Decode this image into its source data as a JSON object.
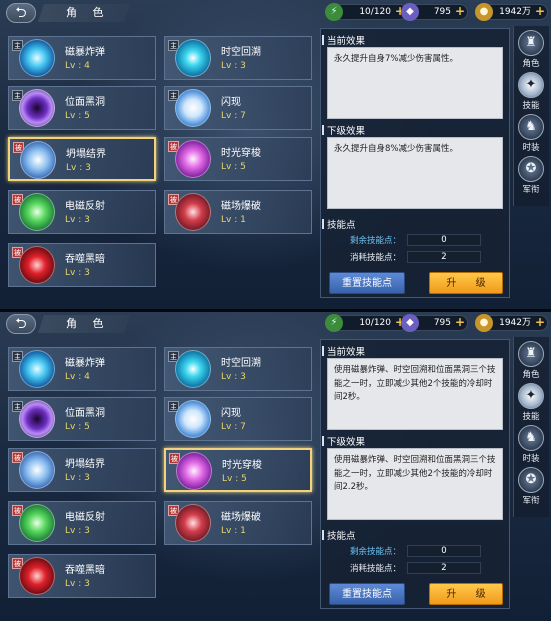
{
  "panels": [
    {
      "header": {
        "back_label": "⮌",
        "title": "角 色"
      },
      "resources": {
        "energy": "10/120",
        "gems": "795",
        "gold": "1942万",
        "plus": "+"
      },
      "skills": [
        {
          "name": "磁暴炸弹",
          "level": "Lv : 4",
          "badge": "主",
          "color": "cyan",
          "selected": false
        },
        {
          "name": "时空回溯",
          "level": "Lv : 3",
          "badge": "主",
          "color": "teal",
          "selected": false
        },
        {
          "name": "位面黑洞",
          "level": "Lv : 5",
          "badge": "主",
          "color": "purple",
          "selected": false
        },
        {
          "name": "闪现",
          "level": "Lv : 7",
          "badge": "主",
          "color": "white",
          "selected": false
        },
        {
          "name": "坍塌结界",
          "level": "Lv : 3",
          "badge": "被",
          "color": "ice",
          "selected": true
        },
        {
          "name": "时光穿梭",
          "level": "Lv : 5",
          "badge": "被",
          "color": "pink",
          "selected": false
        },
        {
          "name": "电磁反射",
          "level": "Lv : 3",
          "badge": "被",
          "color": "green",
          "selected": false
        },
        {
          "name": "磁场爆破",
          "level": "Lv : 1",
          "badge": "被",
          "color": "crimson",
          "selected": false
        },
        {
          "name": "吞噬黑暗",
          "level": "Lv : 3",
          "badge": "被",
          "color": "red",
          "selected": false
        }
      ],
      "info": {
        "current_title": "当前效果",
        "current_text": "永久提升自身7%减少伤害属性。",
        "next_title": "下级效果",
        "next_text": "永久提升自身8%减少伤害属性。",
        "points_title": "技能点",
        "remaining_label": "剩余技能点：",
        "remaining_value": "0",
        "used_label": "消耗技能点：",
        "used_value": "2",
        "reset_label": "重置技能点",
        "upgrade_label": "升 级"
      },
      "tabs": [
        {
          "label": "角色",
          "icon": "helmet-icon",
          "glyph": "♜",
          "active": false
        },
        {
          "label": "技能",
          "icon": "skill-icon",
          "glyph": "✦",
          "active": true
        },
        {
          "label": "时装",
          "icon": "armor-icon",
          "glyph": "♞",
          "active": false
        },
        {
          "label": "军衔",
          "icon": "rank-icon",
          "glyph": "✪",
          "active": false
        }
      ]
    },
    {
      "header": {
        "back_label": "⮌",
        "title": "角 色"
      },
      "resources": {
        "energy": "10/120",
        "gems": "795",
        "gold": "1942万",
        "plus": "+"
      },
      "skills": [
        {
          "name": "磁暴炸弹",
          "level": "Lv : 4",
          "badge": "主",
          "color": "cyan",
          "selected": false
        },
        {
          "name": "时空回溯",
          "level": "Lv : 3",
          "badge": "主",
          "color": "teal",
          "selected": false
        },
        {
          "name": "位面黑洞",
          "level": "Lv : 5",
          "badge": "主",
          "color": "purple",
          "selected": false
        },
        {
          "name": "闪现",
          "level": "Lv : 7",
          "badge": "主",
          "color": "white",
          "selected": false
        },
        {
          "name": "坍塌结界",
          "level": "Lv : 3",
          "badge": "被",
          "color": "ice",
          "selected": false
        },
        {
          "name": "时光穿梭",
          "level": "Lv : 5",
          "badge": "被",
          "color": "pink",
          "selected": true
        },
        {
          "name": "电磁反射",
          "level": "Lv : 3",
          "badge": "被",
          "color": "green",
          "selected": false
        },
        {
          "name": "磁场爆破",
          "level": "Lv : 1",
          "badge": "被",
          "color": "crimson",
          "selected": false
        },
        {
          "name": "吞噬黑暗",
          "level": "Lv : 3",
          "badge": "被",
          "color": "red",
          "selected": false
        }
      ],
      "info": {
        "current_title": "当前效果",
        "current_text": "使用磁暴炸弹、时空回溯和位面黑洞三个技能之一时，立即减少其他2个技能的冷却时间2秒。",
        "next_title": "下级效果",
        "next_text": "使用磁暴炸弹、时空回溯和位面黑洞三个技能之一时，立即减少其他2个技能的冷却时间2.2秒。",
        "points_title": "技能点",
        "remaining_label": "剩余技能点：",
        "remaining_value": "0",
        "used_label": "消耗技能点：",
        "used_value": "2",
        "reset_label": "重置技能点",
        "upgrade_label": "升 级"
      },
      "tabs": [
        {
          "label": "角色",
          "icon": "helmet-icon",
          "glyph": "♜",
          "active": false
        },
        {
          "label": "技能",
          "icon": "skill-icon",
          "glyph": "✦",
          "active": true
        },
        {
          "label": "时装",
          "icon": "armor-icon",
          "glyph": "♞",
          "active": false
        },
        {
          "label": "军衔",
          "icon": "rank-icon",
          "glyph": "✪",
          "active": false
        }
      ]
    }
  ]
}
